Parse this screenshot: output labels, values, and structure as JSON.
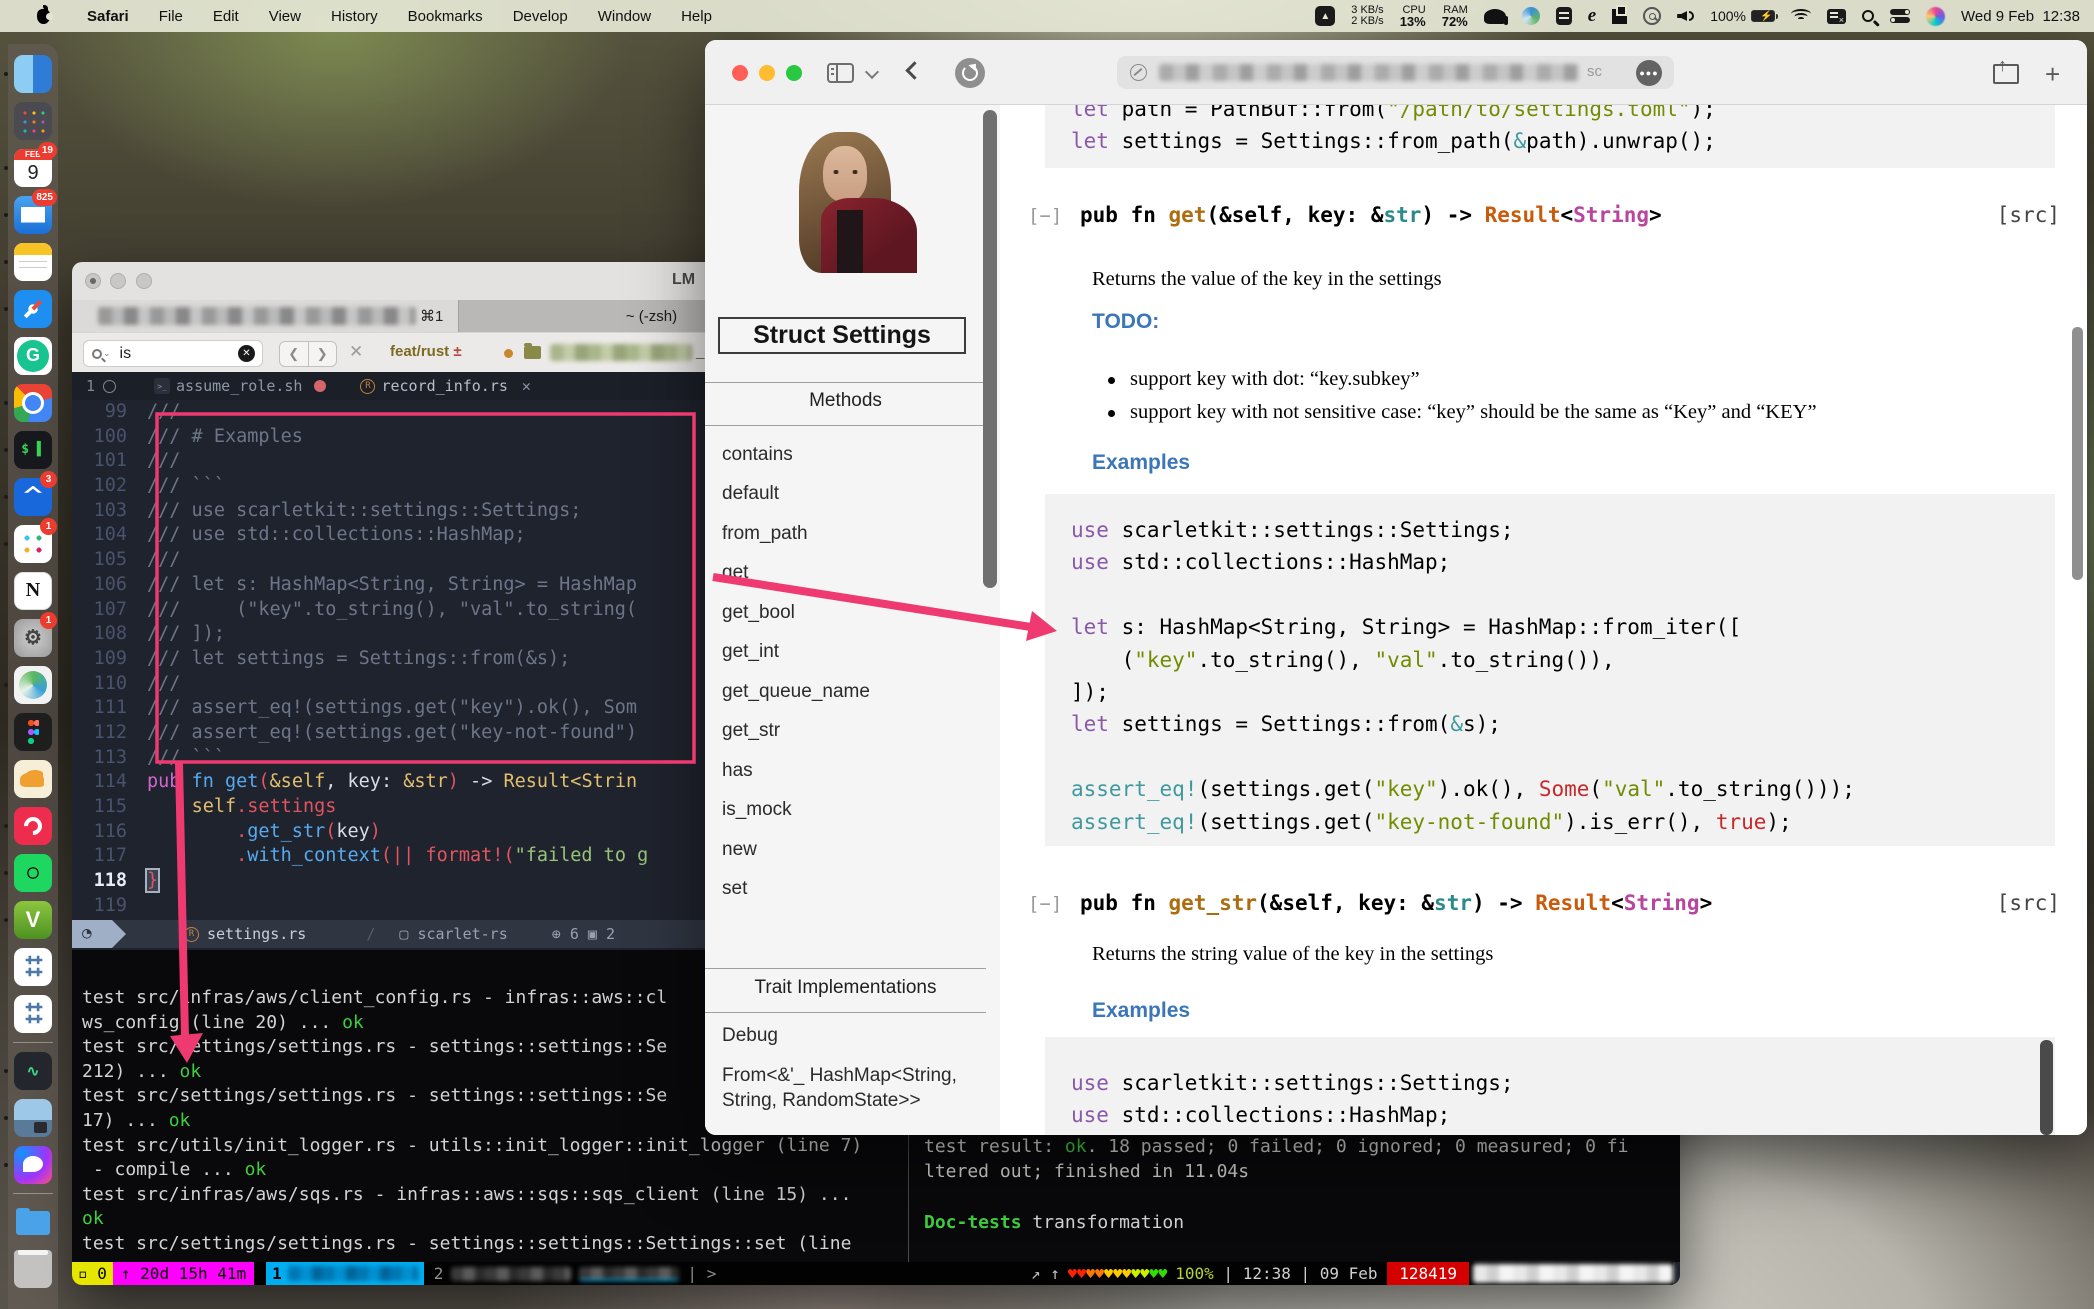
{
  "menubar": {
    "menus": [
      "Safari",
      "File",
      "Edit",
      "View",
      "History",
      "Bookmarks",
      "Develop",
      "Window",
      "Help"
    ],
    "net_up": "3 KB/s",
    "net_down": "2 KB/s",
    "cpu_label": "CPU",
    "cpu": "13%",
    "ram_label": "RAM",
    "ram": "72%",
    "battery": "100%",
    "date": "Wed 9 Feb",
    "time": "12:38"
  },
  "dock": {
    "items": [
      {
        "id": "finder",
        "running": true
      },
      {
        "id": "launchpad",
        "running": false
      },
      {
        "id": "calendar",
        "running": true,
        "badge": "19",
        "cal_month": "FEB",
        "cal_day": "9"
      },
      {
        "id": "mail",
        "running": true,
        "badge": "825"
      },
      {
        "id": "notes",
        "running": true
      },
      {
        "id": "safari",
        "running": true
      },
      {
        "id": "grammarly",
        "running": false
      },
      {
        "id": "chrome",
        "running": true
      },
      {
        "id": "terminal",
        "running": true,
        "glyph": "$ ▌"
      },
      {
        "id": "jira",
        "running": true,
        "badge": "3"
      },
      {
        "id": "slack",
        "running": true,
        "badge": "1"
      },
      {
        "id": "notion",
        "running": false,
        "glyph": "N"
      },
      {
        "id": "system-preferences",
        "running": false,
        "badge": "1",
        "glyph": "⚙"
      },
      {
        "id": "anyconnect",
        "running": true
      },
      {
        "id": "figma",
        "running": false
      },
      {
        "id": "hadoop",
        "running": false
      },
      {
        "id": "authy",
        "running": true
      },
      {
        "id": "spotify",
        "running": true
      },
      {
        "id": "vagrant",
        "running": true,
        "glyph": "V"
      },
      {
        "id": "tableau",
        "running": false
      },
      {
        "id": "tableau-2",
        "running": false
      },
      {
        "id": "separator",
        "sep": true
      },
      {
        "id": "activity-monitor",
        "running": true,
        "glyph": "∿"
      },
      {
        "id": "preview",
        "running": true
      },
      {
        "id": "messenger",
        "running": true
      },
      {
        "id": "separator-2",
        "sep": true
      },
      {
        "id": "downloads",
        "running": false
      },
      {
        "id": "trash",
        "running": false
      }
    ]
  },
  "ide": {
    "title": "LM",
    "tab_shortcut": "⌘1",
    "tab2": "~ (-zsh)",
    "search": {
      "query": "is"
    },
    "nav": {
      "back": "❮",
      "fwd": "❯"
    },
    "branch": "feat/rust",
    "branch_sym": "±",
    "path_tail": "_pl",
    "buffer_tabs": {
      "index": "1",
      "tab1": "assume_role.sh",
      "tab2": "record_info.rs"
    },
    "lines": [
      {
        "n": "99",
        "s": [
          [
            "g",
            "///"
          ]
        ]
      },
      {
        "n": "100",
        "s": [
          [
            "g",
            "/// # Examples"
          ]
        ]
      },
      {
        "n": "101",
        "s": [
          [
            "g",
            "///"
          ]
        ]
      },
      {
        "n": "102",
        "s": [
          [
            "g",
            "/// ```"
          ]
        ]
      },
      {
        "n": "103",
        "s": [
          [
            "g",
            "/// use scarletkit::settings::Settings;"
          ]
        ]
      },
      {
        "n": "104",
        "s": [
          [
            "g",
            "/// use std::collections::HashMap;"
          ]
        ]
      },
      {
        "n": "105",
        "s": [
          [
            "g",
            "///"
          ]
        ]
      },
      {
        "n": "106",
        "s": [
          [
            "g",
            "/// let s: HashMap<String, String> = HashMap"
          ]
        ]
      },
      {
        "n": "107",
        "s": [
          [
            "g",
            "///     (\"key\".to_string(), \"val\".to_string("
          ]
        ]
      },
      {
        "n": "108",
        "s": [
          [
            "g",
            "/// ]);"
          ]
        ]
      },
      {
        "n": "109",
        "s": [
          [
            "g",
            "/// let settings = Settings::from(&s);"
          ]
        ]
      },
      {
        "n": "110",
        "s": [
          [
            "g",
            "///"
          ]
        ]
      },
      {
        "n": "111",
        "s": [
          [
            "g",
            "/// assert_eq!(settings.get(\"key\").ok(), Som"
          ]
        ]
      },
      {
        "n": "112",
        "s": [
          [
            "g",
            "/// assert_eq!(settings.get(\"key-not-found\")"
          ]
        ]
      },
      {
        "n": "113",
        "s": [
          [
            "g",
            "/// ```"
          ]
        ]
      },
      {
        "n": "114",
        "s": [
          [
            "pu",
            "pub "
          ],
          [
            "bl",
            "fn "
          ],
          [
            "bl",
            "get"
          ],
          [
            "rd",
            "("
          ],
          [
            "yl",
            "&self"
          ],
          [
            "wh",
            ", key: "
          ],
          [
            "yl",
            "&str"
          ],
          [
            "rd",
            ")"
          ],
          [
            "wh",
            " -> "
          ],
          [
            "yl",
            "Result<Strin"
          ]
        ]
      },
      {
        "n": "115",
        "s": [
          [
            "wh",
            "    "
          ],
          [
            "yl",
            "self"
          ],
          [
            "rd",
            ".settings"
          ]
        ]
      },
      {
        "n": "116",
        "s": [
          [
            "wh",
            "        "
          ],
          [
            "rd",
            "."
          ],
          [
            "bl",
            "get_str"
          ],
          [
            "rd",
            "("
          ],
          [
            "wh",
            "key"
          ],
          [
            "rd",
            ")"
          ]
        ]
      },
      {
        "n": "117",
        "s": [
          [
            "wh",
            "        "
          ],
          [
            "rd",
            "."
          ],
          [
            "bl",
            "with_context"
          ],
          [
            "rd",
            "(|| "
          ],
          [
            "rd",
            "format!"
          ],
          [
            "rd",
            "("
          ],
          [
            "gr",
            "\"failed to g"
          ]
        ]
      },
      {
        "n": "118",
        "cur": true,
        "s": [
          [
            "cu",
            "}"
          ]
        ]
      },
      {
        "n": "119",
        "s": []
      }
    ],
    "statusline": {
      "file": "settings.rs",
      "project": "scarlet-rs",
      "added": "6",
      "modified": "2"
    },
    "terminal": {
      "left": [
        [
          [
            "w",
            "test src/infras/aws/client_config.rs - infras::aws::cl"
          ]
        ],
        [
          [
            "w",
            "ws_config (line 20) ... "
          ],
          [
            "ok",
            "ok"
          ]
        ],
        [
          [
            "w",
            "test src/settings/settings.rs - settings::settings::Se"
          ]
        ],
        [
          [
            "w",
            "212) ... "
          ],
          [
            "ok",
            "ok"
          ]
        ],
        [
          [
            "w",
            "test src/settings/settings.rs - settings::settings::Se"
          ]
        ],
        [
          [
            "w",
            "17) ... "
          ],
          [
            "ok",
            "ok"
          ]
        ],
        [
          [
            "w",
            "test src/utils/init_logger.rs - utils::init_logger::init_logger (line 7)"
          ]
        ],
        [
          [
            "w",
            " - compile ... "
          ],
          [
            "ok",
            "ok"
          ]
        ],
        [
          [
            "w",
            "test src/infras/aws/sqs.rs - infras::aws::sqs::sqs_client (line 15) ..."
          ]
        ],
        [
          [
            "ok",
            "ok"
          ]
        ],
        [
          [
            "w",
            "test src/settings/settings.rs - settings::settings::Settings::set (line"
          ]
        ]
      ],
      "right": [
        [
          [
            "w",
            "test result: "
          ],
          [
            "ok",
            "ok"
          ],
          [
            "w",
            ". 18 passed; 0 failed; 0 ignored; 0 measured; 0 fi"
          ]
        ],
        [
          [
            "w",
            "ltered out; finished in 11.04s"
          ]
        ],
        [],
        [
          [
            "dg",
            "Doc-tests"
          ],
          [
            "w",
            " transformation"
          ]
        ]
      ]
    },
    "tmux": {
      "session": "0",
      "uptime": "↑ 20d 15h 41m",
      "win1": "1",
      "win2": "2",
      "sep": "| >",
      "arrows": "↗ ↑",
      "hearts": "♥♥♥♥♥♥♥♥♥♥♥",
      "battery": "100%",
      "time": "12:38",
      "date": "09 Feb",
      "count": "128419"
    }
  },
  "safari": {
    "url_tail": "sc",
    "sidebar": {
      "struct_title": "Struct Settings",
      "methods_header": "Methods",
      "methods": [
        "contains",
        "default",
        "from_path",
        "get",
        "get_bool",
        "get_int",
        "get_queue_name",
        "get_str",
        "has",
        "is_mock",
        "new",
        "set"
      ],
      "traits_header": "Trait Implementations",
      "trait_debug": "Debug",
      "trait_from_1": "From<&'_ HashMap<String,",
      "trait_from_2": "String, RandomState>>"
    },
    "main": {
      "collapse": "[−]",
      "src": "[src]",
      "top_code": [
        [
          [
            "k",
            "let"
          ],
          [
            "t",
            " path = PathBuf::from("
          ],
          [
            "s",
            "\"/path/to/settings.toml\""
          ],
          [
            "t",
            ");"
          ]
        ],
        [
          [
            "k",
            "let"
          ],
          [
            "t",
            " settings = Settings::from_path("
          ],
          [
            "m",
            "&"
          ],
          [
            "t",
            "path).unwrap();"
          ]
        ]
      ],
      "fn_get_sig": [
        [
          "t",
          "pub fn "
        ],
        [
          "fn",
          "get"
        ],
        [
          "t",
          "(&self, key: &"
        ],
        [
          "pr",
          "str"
        ],
        [
          "t",
          ") -> "
        ],
        [
          "ty",
          "Result"
        ],
        [
          "t",
          "<"
        ],
        [
          "st",
          "String"
        ],
        [
          "t",
          ">"
        ]
      ],
      "returns_get": "Returns the value of the key in the settings",
      "todo_header": "TODO:",
      "bullets": [
        "support key with dot: “key.subkey”",
        "support key with not sensitive case: “key” should be the same as “Key” and “KEY”"
      ],
      "examples_header": "Examples",
      "code1": [
        [
          [
            "k",
            "use"
          ],
          [
            "t",
            " scarletkit::settings::Settings;"
          ]
        ],
        [
          [
            "k",
            "use"
          ],
          [
            "t",
            " std::collections::HashMap;"
          ]
        ],
        [],
        [
          [
            "k",
            "let"
          ],
          [
            "t",
            " s: HashMap<String, String> = HashMap::from_iter(["
          ]
        ],
        [
          [
            "t",
            "    ("
          ],
          [
            "s",
            "\"key\""
          ],
          [
            "t",
            ".to_string(), "
          ],
          [
            "s",
            "\"val\""
          ],
          [
            "t",
            ".to_string()),"
          ]
        ],
        [
          [
            "t",
            "]);"
          ]
        ],
        [
          [
            "k",
            "let"
          ],
          [
            "t",
            " settings = Settings::from("
          ],
          [
            "m",
            "&"
          ],
          [
            "t",
            "s);"
          ]
        ],
        [],
        [
          [
            "m",
            "assert_eq!"
          ],
          [
            "t",
            "(settings.get("
          ],
          [
            "s",
            "\"key\""
          ],
          [
            "t",
            ").ok(), "
          ],
          [
            "r",
            "Some"
          ],
          [
            "t",
            "("
          ],
          [
            "s",
            "\"val\""
          ],
          [
            "t",
            ".to_string()));"
          ]
        ],
        [
          [
            "m",
            "assert_eq!"
          ],
          [
            "t",
            "(settings.get("
          ],
          [
            "s",
            "\"key-not-found\""
          ],
          [
            "t",
            ").is_err(), "
          ],
          [
            "r",
            "true"
          ],
          [
            "t",
            ");"
          ]
        ]
      ],
      "fn_get_str_sig": [
        [
          "t",
          "pub fn "
        ],
        [
          "fn",
          "get_str"
        ],
        [
          "t",
          "(&self, key: &"
        ],
        [
          "pr",
          "str"
        ],
        [
          "t",
          ") -> "
        ],
        [
          "ty",
          "Result"
        ],
        [
          "t",
          "<"
        ],
        [
          "st",
          "String"
        ],
        [
          "t",
          ">"
        ]
      ],
      "returns_get_str": "Returns the string value of the key in the settings",
      "code2": [
        [
          [
            "k",
            "use"
          ],
          [
            "t",
            " scarletkit::settings::Settings;"
          ]
        ],
        [
          [
            "k",
            "use"
          ],
          [
            "t",
            " std::collections::HashMap;"
          ]
        ]
      ]
    }
  }
}
